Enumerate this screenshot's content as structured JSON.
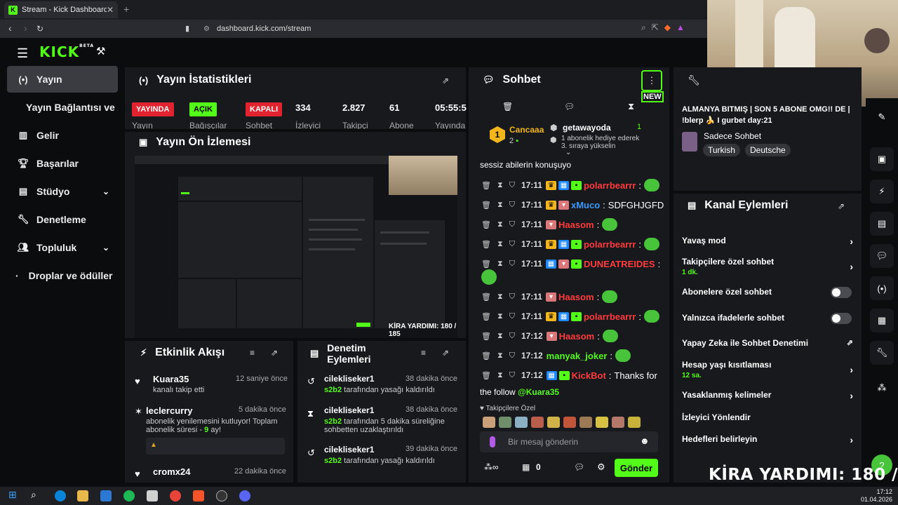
{
  "browser": {
    "tab_title": "Stream - Kick Dashboard",
    "url": "dashboard.kick.com/stream"
  },
  "app": {
    "logo": "KICK",
    "logo_sup": "BETA"
  },
  "sidebar": {
    "items": [
      {
        "label": "Yayın",
        "icon": "broadcast-icon"
      },
      {
        "label": "Yayın Bağlantısı ve Anahtarı",
        "icon": ""
      },
      {
        "label": "Gelir",
        "icon": "chart-icon"
      },
      {
        "label": "Başarılar",
        "icon": "trophy-icon"
      },
      {
        "label": "Stüdyo",
        "icon": "studio-icon"
      },
      {
        "label": "Denetleme",
        "icon": "wrench-icon"
      },
      {
        "label": "Topluluk",
        "icon": "community-icon"
      },
      {
        "label": "Droplar ve ödüller",
        "icon": "dot-icon"
      }
    ]
  },
  "stats": {
    "title": "Yayın İstatistikleri",
    "badges": [
      {
        "text": "YAYINDA",
        "color": "#e0232e",
        "label": "Yayın"
      },
      {
        "text": "AÇIK",
        "color": "#53fc18",
        "label": "Bağışçılar"
      },
      {
        "text": "KAPALI",
        "color": "#e0232e",
        "label": "Sohbet"
      }
    ],
    "numbers": [
      {
        "value": "334",
        "label": "İzleyici"
      },
      {
        "value": "2.827",
        "label": "Takipçi"
      },
      {
        "value": "61",
        "label": "Abone"
      },
      {
        "value": "05:55:5",
        "label": "Yayında"
      }
    ]
  },
  "preview": {
    "title": "Yayın Ön İzlemesi",
    "caption": "KİRA YARDIMI: 180 / 185"
  },
  "activity": {
    "title": "Etkinlik Akışı",
    "items": [
      {
        "name": "Kuara35",
        "time": "12 saniye önce",
        "sub": "kanalı takip etti",
        "icon": "heart-icon"
      },
      {
        "name": "leclercurry",
        "time": "5 dakika önce",
        "sub1": "abonelik yenilemesini kutluyor! Toplam",
        "sub2": "abonelik süresi - ",
        "months": "9",
        "sub3": " ay!",
        "icon": "star-icon"
      },
      {
        "name": "cromx24",
        "time": "22 dakika önce",
        "icon": "heart-icon"
      }
    ]
  },
  "modactions": {
    "title": "Denetim Eylemleri",
    "items": [
      {
        "name": "cilekliseker1",
        "time": "38 dakika önce",
        "mod": "s2b2",
        "text": "tarafından yasağı kaldırıldı",
        "text2": "",
        "icon": "unban-icon"
      },
      {
        "name": "cilekliseker1",
        "time": "38 dakika önce",
        "mod": "s2b2",
        "text": "tarafından 5 dakika süreliğine",
        "text2": "sohbetten uzaklaştırıldı",
        "icon": "timeout-icon"
      },
      {
        "name": "cilekliseker1",
        "time": "39 dakika önce",
        "mod": "s2b2",
        "text": "tarafından yasağı kaldırıldı",
        "text2": "",
        "icon": "unban-icon"
      }
    ]
  },
  "chat": {
    "title": "Sohbet",
    "new_label": "NEW",
    "top_gifter": {
      "rank": "1",
      "name": "Cancaaa",
      "count": "2"
    },
    "gifter2": {
      "name": "getawayoda",
      "count": "1",
      "line1": "1 abonelik hediye ederek",
      "line2": "3. sıraya yükselin"
    },
    "pinned": "sessiz abilerin konuşuyo",
    "messages": [
      {
        "time": "17:11",
        "badges": [
          "crown",
          "sub",
          "gift"
        ],
        "user": "polarrbearrr",
        "color": "#ff3b3b",
        "text": "",
        "emote": true
      },
      {
        "time": "17:11",
        "badges": [
          "crown",
          "cup"
        ],
        "user": "xMuco",
        "color": "#3a9bff",
        "text": "SDFGHJGFD",
        "emote": false
      },
      {
        "time": "17:11",
        "badges": [
          "cup"
        ],
        "user": "Haasom",
        "color": "#ff3b3b",
        "text": "",
        "emote": true
      },
      {
        "time": "17:11",
        "badges": [
          "crown",
          "sub",
          "gift"
        ],
        "user": "polarrbearrr",
        "color": "#ff3b3b",
        "text": "",
        "emote": true
      },
      {
        "time": "17:11",
        "badges": [
          "sub",
          "cup",
          "gift"
        ],
        "user": "DUNEATREIDES",
        "color": "#ff3b3b",
        "text": "",
        "emote": false
      },
      {
        "time": "17:11",
        "badges": [
          "cup"
        ],
        "user": "Haasom",
        "color": "#ff3b3b",
        "text": "",
        "emote": true
      },
      {
        "time": "17:11",
        "badges": [
          "crown",
          "sub",
          "gift"
        ],
        "user": "polarrbearrr",
        "color": "#ff3b3b",
        "text": "",
        "emote": true
      },
      {
        "time": "17:12",
        "badges": [
          "cup"
        ],
        "user": "Haasom",
        "color": "#ff3b3b",
        "text": "",
        "emote": true
      },
      {
        "time": "17:12",
        "badges": [],
        "user": "manyak_joker",
        "color": "#53fc18",
        "text": "",
        "emote": true
      },
      {
        "time": "17:12",
        "badges": [
          "sub",
          "gift"
        ],
        "user": "KickBot",
        "color": "#ff3b3b",
        "text": "Thanks for",
        "emote": false
      }
    ],
    "kickbot_line2": "the follow",
    "kickbot_mention": "@Kuara35",
    "followers_only": "Takipçilere Özel",
    "input_placeholder": "Bir mesaj gönderin",
    "points": "0",
    "send_label": "Gönder"
  },
  "channel_info": {
    "title_text": "ALMANYA BITMIŞ | SON 5 ABONE OMG!! DE | !blerp 🍌 I gurbet day:21",
    "category": "Sadece Sohbet",
    "tags": [
      "Turkish",
      "Deutsche"
    ]
  },
  "channel_actions": {
    "title": "Kanal Eylemleri",
    "items": [
      {
        "label": "Yavaş mod",
        "sub": "",
        "control": "chevron"
      },
      {
        "label": "Takipçilere özel sohbet",
        "sub": "1 dk.",
        "control": "chevron"
      },
      {
        "label": "Abonelere özel sohbet",
        "sub": "",
        "control": "toggle"
      },
      {
        "label": "Yalnızca ifadelerle sohbet",
        "sub": "",
        "control": "toggle"
      },
      {
        "label": "Yapay Zeka ile Sohbet Denetimi",
        "sub": "",
        "control": "external"
      },
      {
        "label": "Hesap yaşı kısıtlaması",
        "sub": "12 sa.",
        "control": "chevron"
      },
      {
        "label": "Yasaklanmış kelimeler",
        "sub": "",
        "control": "chevron"
      },
      {
        "label": "İzleyici Yönlendir",
        "sub": "",
        "control": "none"
      },
      {
        "label": "Hedefleri belirleyin",
        "sub": "",
        "control": "chevron"
      }
    ]
  },
  "overlay_caption": "KİRA YARDIMI:  180 / 185",
  "clock": {
    "time": "17:12",
    "date": "01.04.2026"
  }
}
